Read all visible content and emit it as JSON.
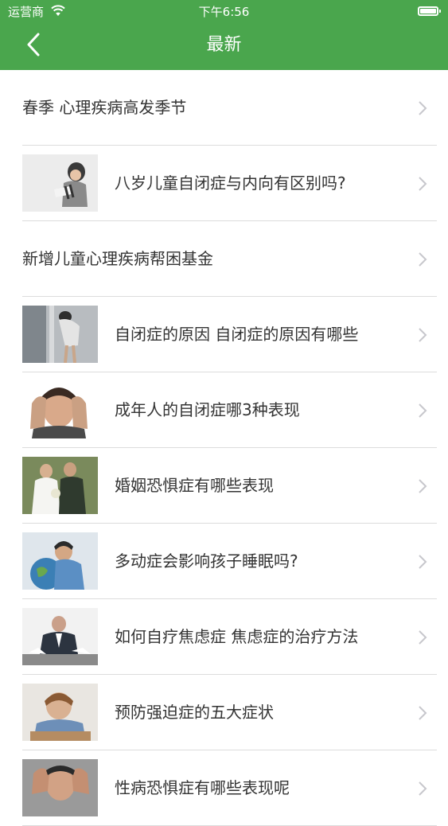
{
  "status_bar": {
    "carrier": "运营商",
    "time": "下午6:56"
  },
  "header": {
    "title": "最新"
  },
  "articles": [
    {
      "title": "春季 心理疾病高发季节",
      "thumbnail": null
    },
    {
      "title": "八岁儿童自闭症与内向有区别吗?",
      "thumbnail": "child-photo"
    },
    {
      "title": "新增儿童心理疾病帮困基金",
      "thumbnail": null
    },
    {
      "title": "自闭症的原因  自闭症的原因有哪些",
      "thumbnail": "person-leaning-photo"
    },
    {
      "title": "成年人的自闭症哪3种表现",
      "thumbnail": "stressed-man-photo"
    },
    {
      "title": "婚姻恐惧症有哪些表现",
      "thumbnail": "wedding-couple-photo"
    },
    {
      "title": "多动症会影响孩子睡眠吗?",
      "thumbnail": "child-globe-photo"
    },
    {
      "title": "如何自疗焦虑症  焦虑症的治疗方法",
      "thumbnail": "businessman-desk-photo"
    },
    {
      "title": "预防强迫症的五大症状",
      "thumbnail": "child-desk-photo"
    },
    {
      "title": "性病恐惧症有哪些表现呢",
      "thumbnail": "man-hands-head-photo"
    }
  ],
  "colors": {
    "header_bg": "#4aa64d",
    "text": "#333333",
    "separator": "#dcdcdc",
    "chevron": "#c7c7cc"
  }
}
